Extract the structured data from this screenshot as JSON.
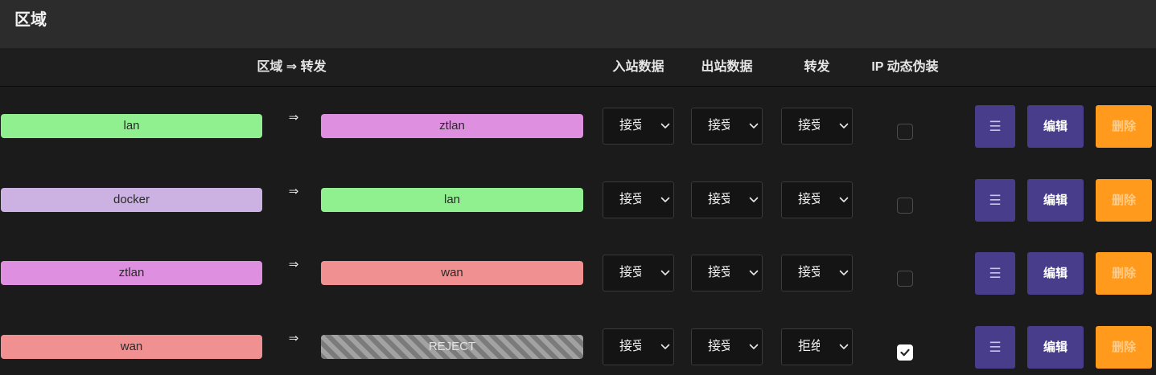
{
  "page": {
    "title": "区域"
  },
  "theme": {
    "primary": "#483d8b",
    "danger": "#ff9a1c"
  },
  "columns": {
    "zone_forward": "区域 ⇒ 转发",
    "input": "入站数据",
    "output": "出站数据",
    "forward": "转发",
    "masquerade": "IP 动态伪装"
  },
  "arrow": "⇒",
  "actions": {
    "sort_icon": "☰",
    "edit_label": "编辑",
    "delete_label": "删除"
  },
  "icons": {
    "select_chevron": "chevron-down-icon",
    "checkbox_mark": "checkmark-icon"
  },
  "zones": [
    {
      "name": "lan",
      "color": "#90f090",
      "forwards_to": {
        "name": "ztlan",
        "color": "#df8fdf"
      },
      "input": "接受",
      "output": "接受",
      "forward": "接受",
      "masquerade": false
    },
    {
      "name": "docker",
      "color": "#cbb2e2",
      "forwards_to": {
        "name": "lan",
        "color": "#90f090"
      },
      "input": "接受",
      "output": "接受",
      "forward": "接受",
      "masquerade": false
    },
    {
      "name": "ztlan",
      "color": "#df8fdf",
      "forwards_to": {
        "name": "wan",
        "color": "#f09090"
      },
      "input": "接受",
      "output": "接受",
      "forward": "接受",
      "masquerade": false
    },
    {
      "name": "wan",
      "color": "#f09090",
      "forwards_to": {
        "name": "REJECT",
        "color": null
      },
      "input": "接受",
      "output": "接受",
      "forward": "拒绝",
      "masquerade": true
    }
  ]
}
